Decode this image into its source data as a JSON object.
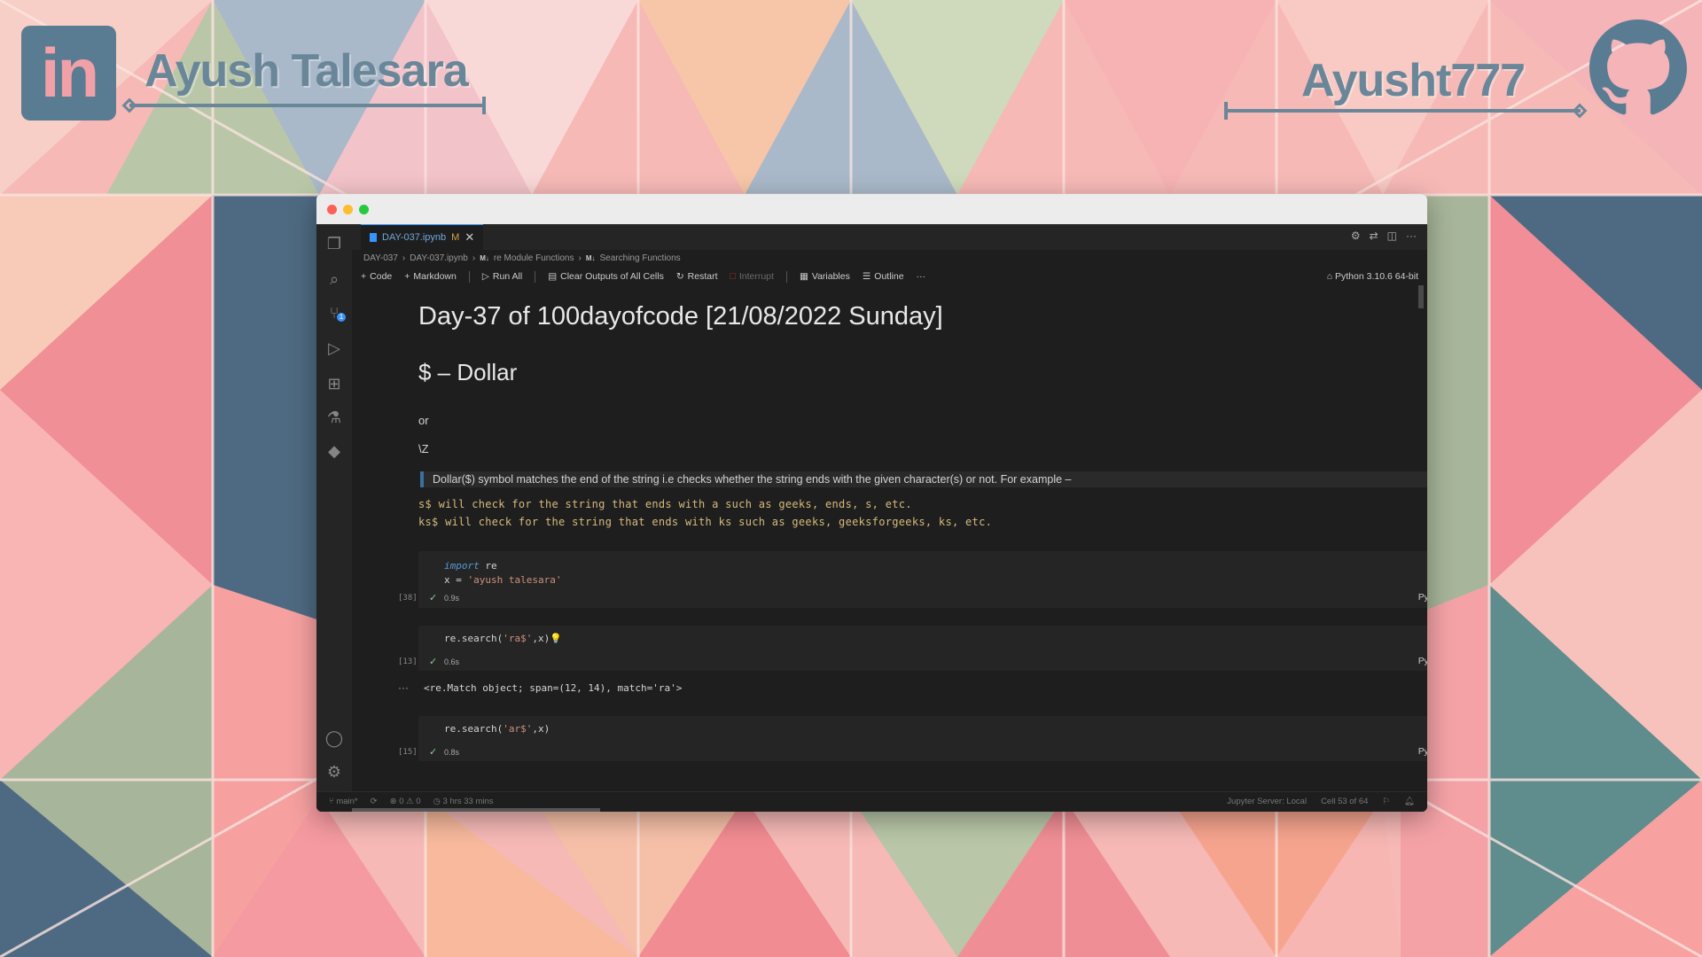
{
  "branding": {
    "linkedin_logo_text": "in",
    "linkedin_name": "Ayush Talesara",
    "github_name": "Ayusht777",
    "accent_color": "#6a8799"
  },
  "window": {
    "tab": {
      "filename": "DAY-037.ipynb",
      "modified_flag": "M"
    },
    "breadcrumbs": [
      "DAY-037",
      "DAY-037.ipynb",
      "re Module Functions",
      "Searching Functions"
    ],
    "breadcrumb_tags": {
      "md1": "M↓",
      "md2": "M↓"
    },
    "toolbar": {
      "code": "Code",
      "markdown": "Markdown",
      "run_all": "Run All",
      "clear_outputs": "Clear Outputs of All Cells",
      "restart": "Restart",
      "interrupt": "Interrupt",
      "variables": "Variables",
      "outline": "Outline",
      "more": "···"
    },
    "kernel": "Python 3.10.6 64-bit",
    "notebook": {
      "h1": "Day-37 of 100dayofcode [21/08/2022 Sunday]",
      "h2": "$ – Dollar",
      "p_or": "or",
      "p_z": "\\Z",
      "blockquote": "Dollar($) symbol matches the end of the string i.e checks whether the string ends with the given character(s) or not. For example –",
      "code_line_1": "s$ will check for the string that ends with a such as geeks, ends, s, etc.",
      "code_line_2": "ks$ will check for the string that ends with ks such as geeks, geeksforgeeks, ks, etc.",
      "cells": [
        {
          "count": "[38]",
          "line1_kw": "import",
          "line1_rest": " re",
          "line2_var": "x  = ",
          "line2_str": "'ayush talesara'",
          "duration": "0.9s",
          "lang": "Python"
        },
        {
          "count": "[13]",
          "code_prefix": "re.search(",
          "code_str1": "'ra$'",
          "code_suffix": ",x)",
          "duration": "0.6s",
          "lang": "Python",
          "output_marker": "···",
          "output": "<re.Match object; span=(12, 14), match='ra'>"
        },
        {
          "count": "[15]",
          "code_prefix": "re.search(",
          "code_str1": "'ar$'",
          "code_suffix": ",x)",
          "duration": "0.8s",
          "lang": "Python"
        }
      ]
    },
    "statusbar": {
      "branch": "main*",
      "problems": "⊗ 0 ⚠ 0",
      "time_spent": "3 hrs 33 mins",
      "jupyter_server": "Jupyter Server: Local",
      "cell_position": "Cell 53 of 64"
    }
  }
}
